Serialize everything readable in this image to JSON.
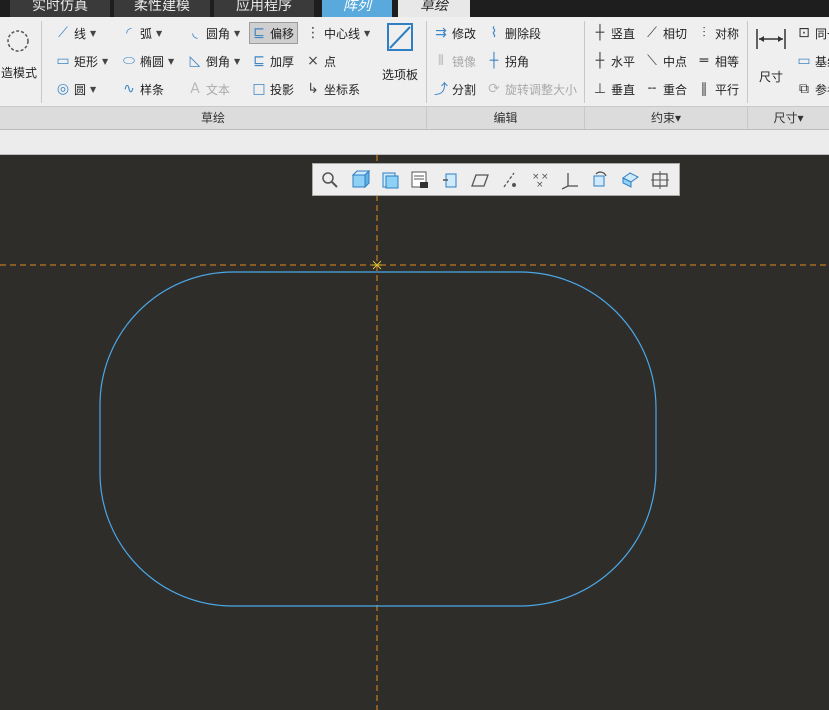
{
  "tabs": [
    {
      "label": "实时仿真"
    },
    {
      "label": "柔性建模"
    },
    {
      "label": "应用程序"
    },
    {
      "label": "阵列"
    },
    {
      "label": "草绘"
    }
  ],
  "ribbon": {
    "left_partial": {
      "label": "造模式"
    },
    "sketch": {
      "line": "线",
      "arc": "弧",
      "fillet": "圆角",
      "offset": "偏移",
      "centerline": "中心线",
      "rectangle": "矩形",
      "ellipse": "椭圆",
      "chamfer": "倒角",
      "thicken": "加厚",
      "point": "点",
      "circle": "圆",
      "spline": "样条",
      "text": "文本",
      "project": "投影",
      "coord_sys": "坐标系",
      "palette": "选项板",
      "group_label": "草绘"
    },
    "edit": {
      "modify": "修改",
      "delete_segment": "删除段",
      "mirror": "镜像",
      "corner": "拐角",
      "divide": "分割",
      "rotate_resize": "旋转调整大小",
      "group_label": "编辑"
    },
    "constrain": {
      "vertical": "竖直",
      "tangent": "相切",
      "symmetric": "对称",
      "horizontal": "水平",
      "midpoint": "中点",
      "equal": "相等",
      "perpendicular": "垂直",
      "coincident": "重合",
      "parallel": "平行",
      "group_label": "约束▾"
    },
    "dimension": {
      "dimension": "尺寸",
      "same_partial": "同一",
      "base_partial": "基线",
      "ref_partial": "参考",
      "group_label": "尺寸▾"
    }
  },
  "view_toolbar": {
    "icons": [
      "zoom-icon",
      "display-style-icon",
      "saved-views-icon",
      "view-manager-icon",
      "datum-display-icon",
      "plane-display-icon",
      "axis-display-icon",
      "point-display-icon",
      "csys-display-icon",
      "spin-center-icon",
      "annotation-display-icon",
      "sketch-view-icon"
    ]
  },
  "colors": {
    "canvas": "#2f2d2a",
    "centerline": "#e08a1e",
    "sketch_entity": "#4aa8e8",
    "accent_tab": "#5aa9dc"
  }
}
